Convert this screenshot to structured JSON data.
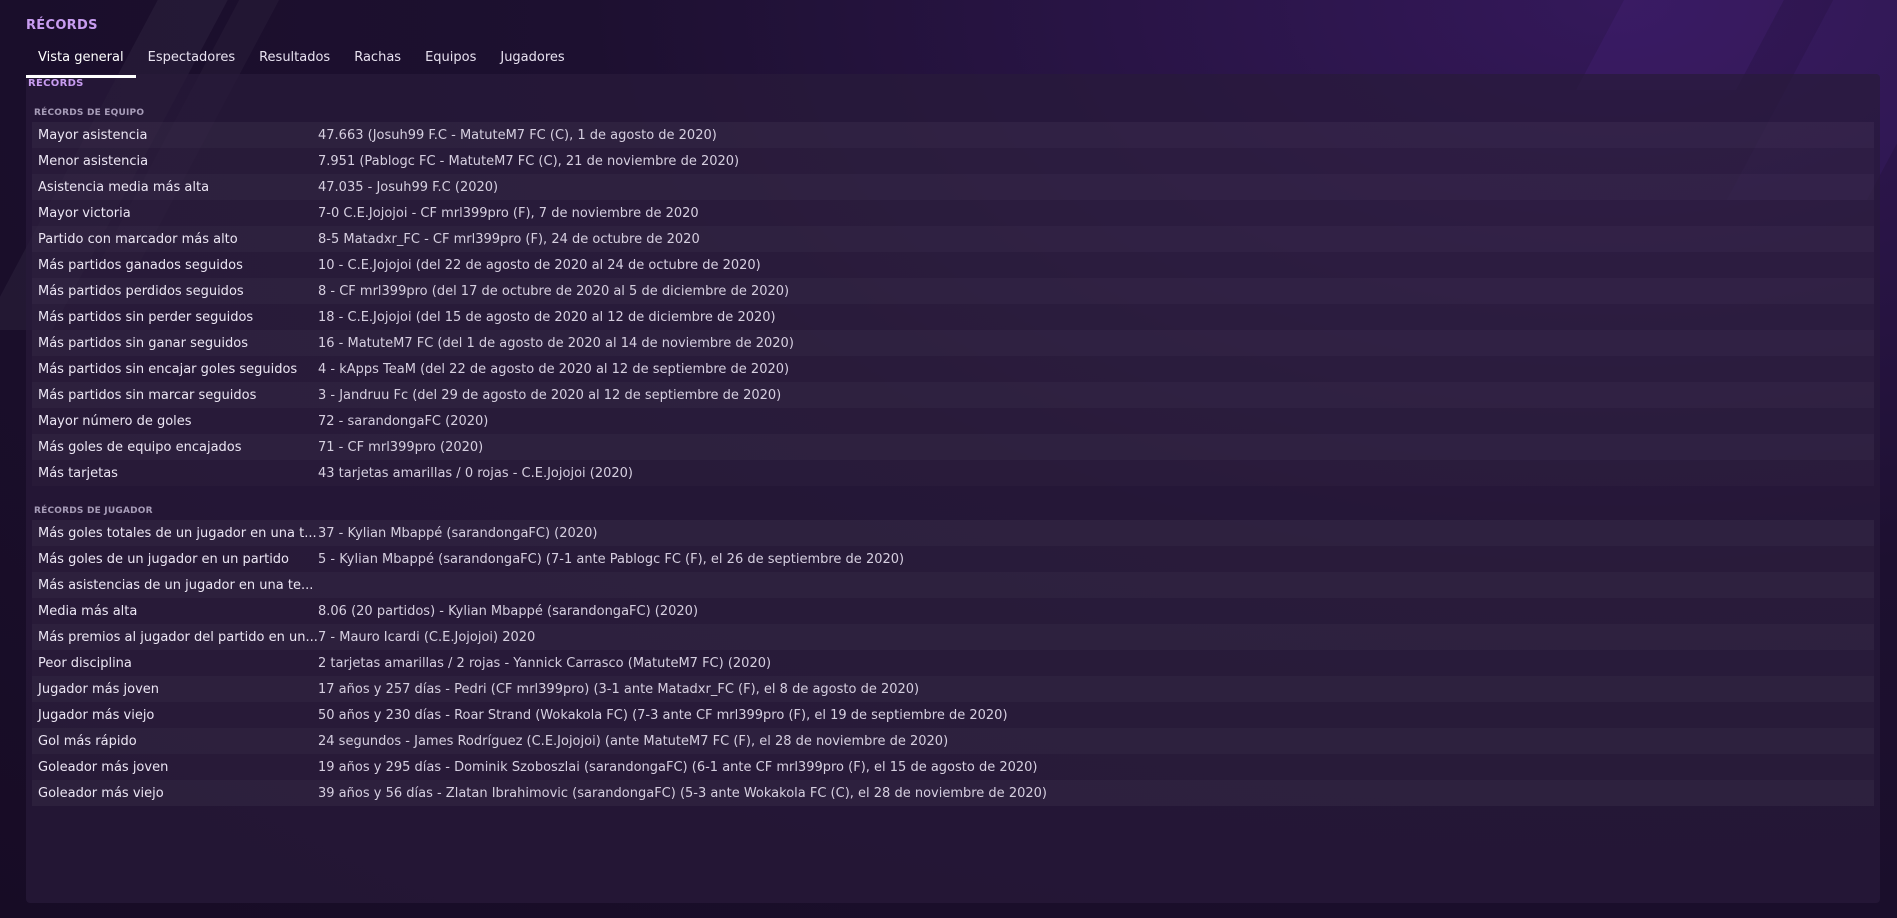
{
  "page_title": "RÉCORDS",
  "tabs": [
    {
      "label": "Vista general"
    },
    {
      "label": "Espectadores"
    },
    {
      "label": "Resultados"
    },
    {
      "label": "Rachas"
    },
    {
      "label": "Equipos"
    },
    {
      "label": "Jugadores"
    }
  ],
  "panel_label": "RÉCORDS",
  "team_section": {
    "header": "RÉCORDS DE EQUIPO",
    "rows": [
      {
        "label": "Mayor asistencia",
        "value": "47.663 (Josuh99 F.C - MatuteM7 FC (C), 1 de agosto de 2020)"
      },
      {
        "label": "Menor asistencia",
        "value": "7.951 (Pablogc FC - MatuteM7 FC (C), 21 de noviembre de 2020)"
      },
      {
        "label": "Asistencia media más alta",
        "value": "47.035 - Josuh99 F.C (2020)"
      },
      {
        "label": "Mayor victoria",
        "value": "7-0 C.E.Jojojoi - CF mrl399pro (F), 7 de noviembre de 2020"
      },
      {
        "label": "Partido con marcador más alto",
        "value": "8-5 Matadxr_FC - CF mrl399pro (F), 24 de octubre de 2020"
      },
      {
        "label": "Más partidos ganados seguidos",
        "value": "10 - C.E.Jojojoi (del 22 de agosto de 2020 al 24 de octubre de 2020)"
      },
      {
        "label": "Más partidos perdidos seguidos",
        "value": "8 - CF mrl399pro (del 17 de octubre de 2020 al 5 de diciembre de 2020)"
      },
      {
        "label": "Más partidos sin perder seguidos",
        "value": "18 - C.E.Jojojoi (del 15 de agosto de 2020 al 12 de diciembre de 2020)"
      },
      {
        "label": "Más partidos sin ganar seguidos",
        "value": "16 - MatuteM7 FC (del 1 de agosto de 2020 al 14 de noviembre de 2020)"
      },
      {
        "label": "Más partidos sin encajar goles seguidos",
        "value": "4 - kApps TeaM (del 22 de agosto de 2020 al 12 de septiembre de 2020)"
      },
      {
        "label": "Más partidos sin marcar seguidos",
        "value": "3 - Jandruu Fc (del 29 de agosto de 2020 al 12 de septiembre de 2020)"
      },
      {
        "label": "Mayor número de goles",
        "value": "72 - sarandongaFC (2020)"
      },
      {
        "label": "Más goles de equipo encajados",
        "value": "71 - CF mrl399pro (2020)"
      },
      {
        "label": "Más tarjetas",
        "value": "43 tarjetas amarillas / 0 rojas - C.E.Jojojoi (2020)"
      }
    ]
  },
  "player_section": {
    "header": "RÉCORDS DE JUGADOR",
    "rows": [
      {
        "label": "Más goles totales de un jugador en una t...",
        "value": "37 - Kylian Mbappé (sarandongaFC) (2020)"
      },
      {
        "label": "Más goles de un jugador en un partido",
        "value": "5 - Kylian Mbappé (sarandongaFC) (7-1 ante Pablogc FC (F), el 26 de septiembre de 2020)"
      },
      {
        "label": "Más asistencias de un jugador en una te...",
        "value": ""
      },
      {
        "label": "Media más alta",
        "value": "8.06 (20 partidos) - Kylian Mbappé (sarandongaFC) (2020)"
      },
      {
        "label": "Más premios al jugador del partido en un...",
        "value": "7 - Mauro Icardi (C.E.Jojojoi) 2020"
      },
      {
        "label": "Peor disciplina",
        "value": "2 tarjetas amarillas / 2 rojas - Yannick Carrasco (MatuteM7 FC) (2020)"
      },
      {
        "label": "Jugador más joven",
        "value": "17 años y 257 días - Pedri (CF mrl399pro) (3-1 ante Matadxr_FC (F), el 8 de agosto de 2020)"
      },
      {
        "label": "Jugador más viejo",
        "value": "50 años y 230 días - Roar Strand (Wokakola FC) (7-3 ante CF mrl399pro (F), el 19 de septiembre de 2020)"
      },
      {
        "label": "Gol más rápido",
        "value": "24 segundos - James Rodríguez (C.E.Jojojoi) (ante MatuteM7 FC (F), el 28 de noviembre de 2020)"
      },
      {
        "label": "Goleador más joven",
        "value": "19 años y 295 días - Dominik Szoboszlai (sarandongaFC) (6-1 ante CF mrl399pro (F), el 15 de agosto de 2020)"
      },
      {
        "label": "Goleador más viejo",
        "value": "39 años y 56 días - Zlatan Ibrahimovic (sarandongaFC) (5-3 ante Wokakola FC (C), el 28 de noviembre de 2020)"
      }
    ]
  }
}
